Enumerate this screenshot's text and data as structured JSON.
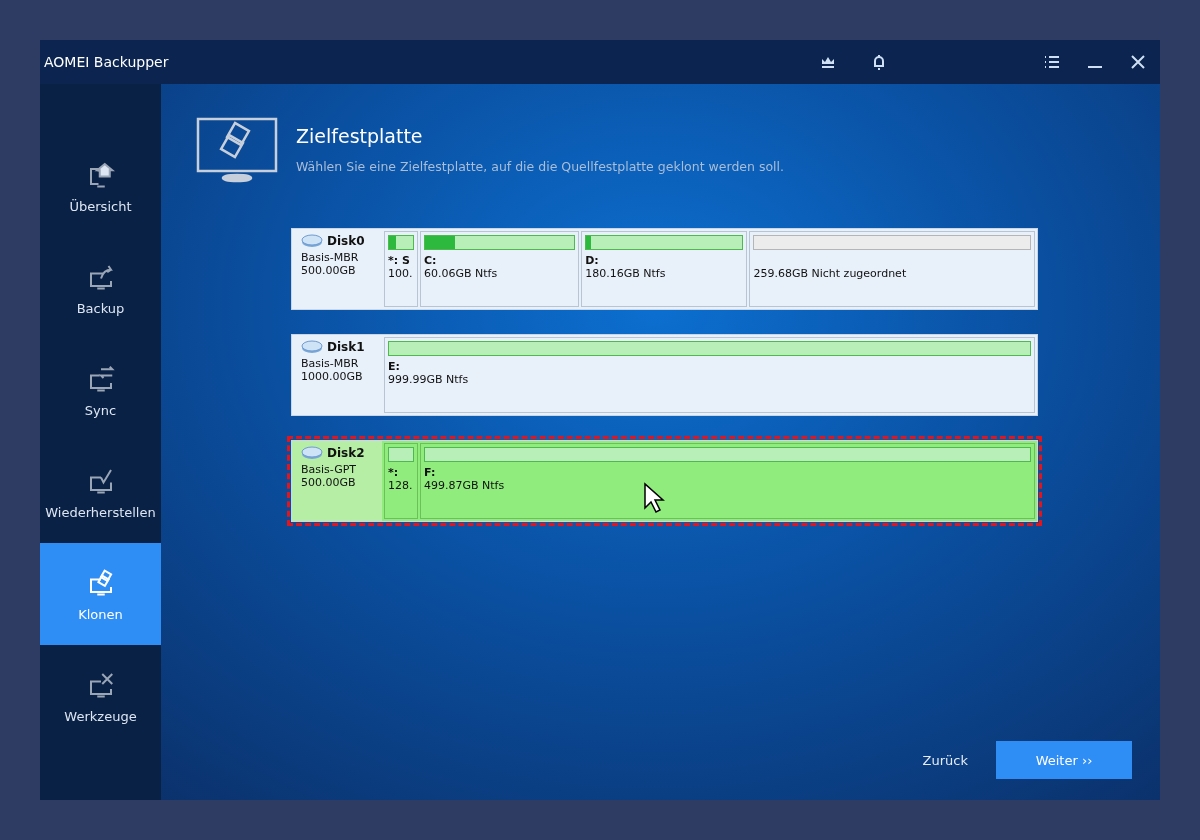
{
  "window": {
    "title": "AOMEI Backupper"
  },
  "sidebar": {
    "items": [
      {
        "label": "Übersicht",
        "kind": "home",
        "selected": false
      },
      {
        "label": "Backup",
        "kind": "backup",
        "selected": false
      },
      {
        "label": "Sync",
        "kind": "sync",
        "selected": false
      },
      {
        "label": "Wiederherstellen",
        "kind": "restore",
        "selected": false
      },
      {
        "label": "Klonen",
        "kind": "clone",
        "selected": true
      },
      {
        "label": "Werkzeuge",
        "kind": "tools",
        "selected": false
      }
    ]
  },
  "header": {
    "title": "Zielfestplatte",
    "subtitle": "Wählen Sie eine Zielfestplatte, auf die die Quellfestplatte geklont werden soll."
  },
  "disks": [
    {
      "name": "Disk0",
      "type": "Basis-MBR",
      "size": "500.00GB",
      "selected": false,
      "partitions": [
        {
          "kind": "narrow",
          "label": "*: S",
          "detail": "100.",
          "level": 0.3
        },
        {
          "kind": "allocated",
          "label": "C:",
          "detail": "60.06GB Ntfs",
          "level": 0.2
        },
        {
          "kind": "allocated",
          "label": "D:",
          "detail": "180.16GB Ntfs",
          "level": 0.03
        },
        {
          "kind": "unallocated",
          "detail": "259.68GB Nicht zugeordnet"
        }
      ]
    },
    {
      "name": "Disk1",
      "type": "Basis-MBR",
      "size": "1000.00GB",
      "selected": false,
      "partitions": [
        {
          "kind": "allocated",
          "label": "E:",
          "detail": "999.99GB Ntfs"
        }
      ]
    },
    {
      "name": "Disk2",
      "type": "Basis-GPT",
      "size": "500.00GB",
      "selected": true,
      "partitions": [
        {
          "kind": "narrow",
          "label": "*:",
          "detail": "128."
        },
        {
          "kind": "allocated",
          "label": "F:",
          "detail": "499.87GB Ntfs"
        }
      ]
    }
  ],
  "buttons": {
    "back": "Zurück",
    "next": "Weiter ››"
  }
}
